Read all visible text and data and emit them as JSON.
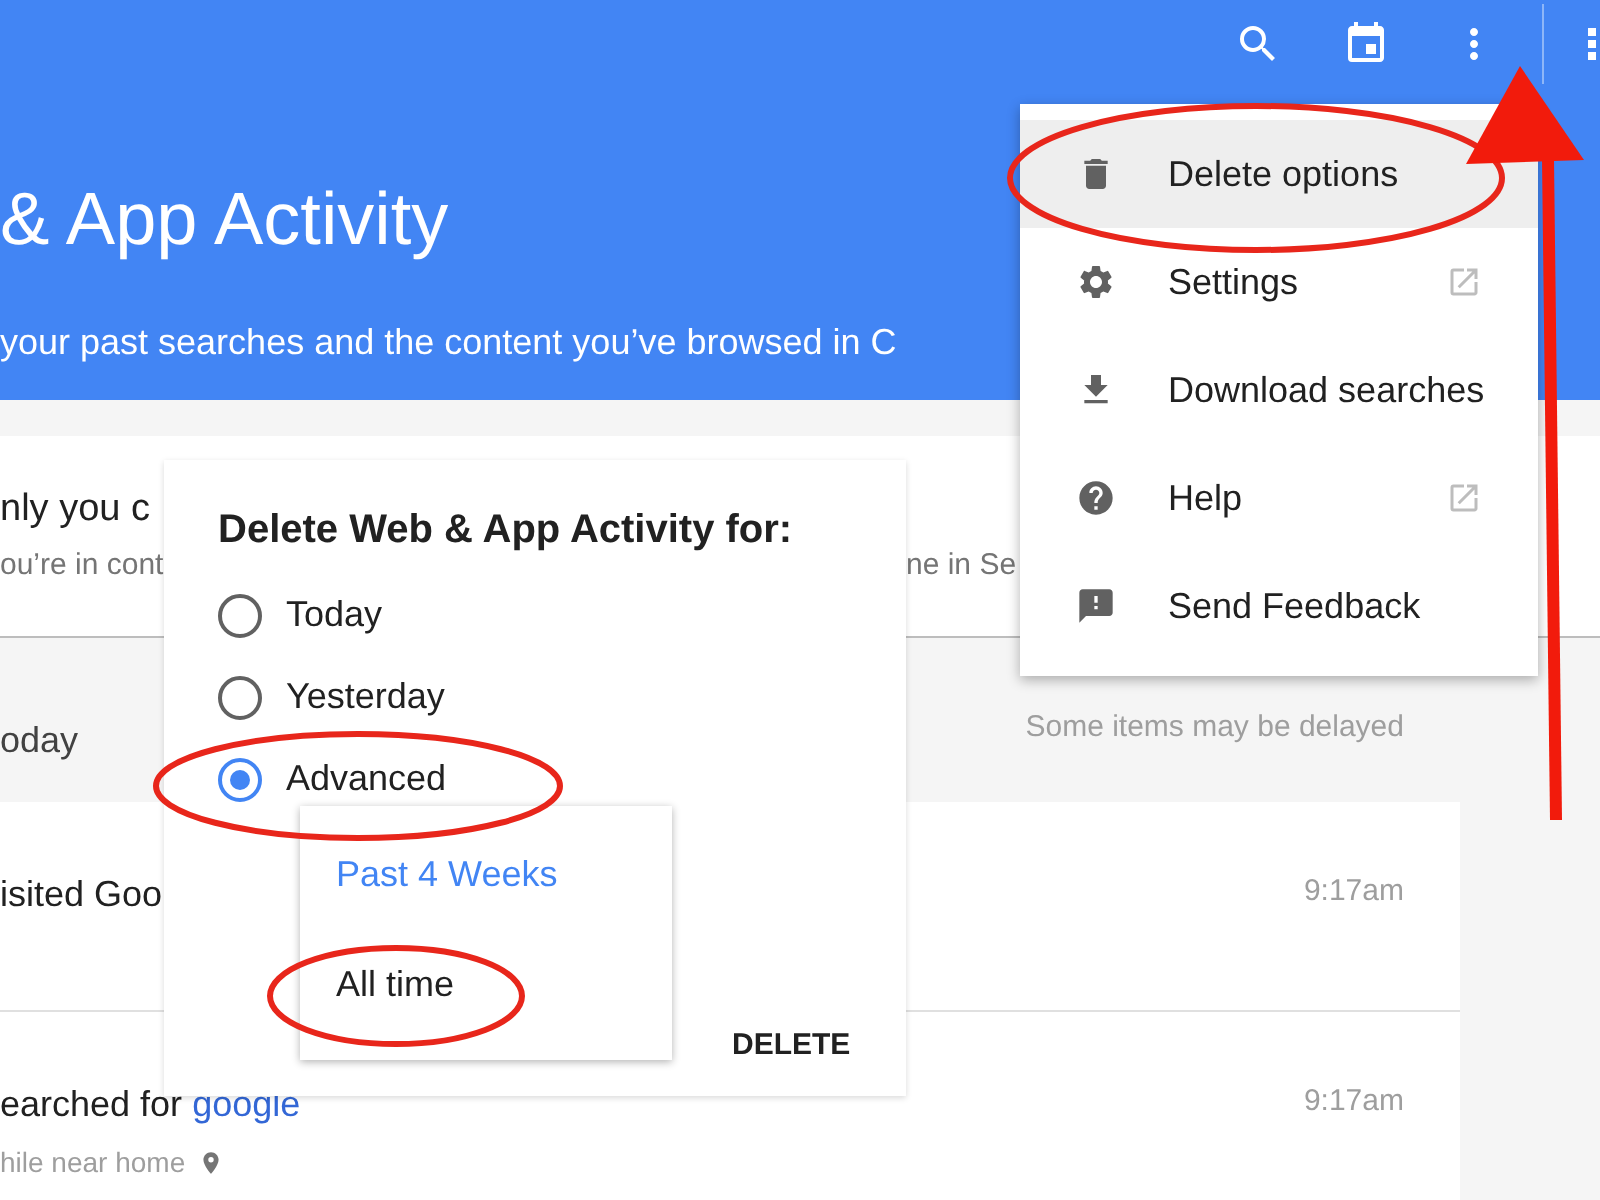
{
  "header": {
    "title": "& App Activity",
    "subtitle": "your past searches and the content you’ve browsed in C"
  },
  "notice": {
    "heading": "nly you c",
    "body": "ou’re in cont",
    "body_right": "ne in Se"
  },
  "day": {
    "label": "oday",
    "note": "Some items may be delayed"
  },
  "activity": [
    {
      "text": "isited Goo",
      "time": "9:17am"
    },
    {
      "text": "earched for",
      "link": "google",
      "detail": "hile near home",
      "time": "9:17am"
    }
  ],
  "menu": {
    "items": [
      {
        "label": "Delete options",
        "highlighted": true,
        "external": false
      },
      {
        "label": "Settings",
        "highlighted": false,
        "external": true
      },
      {
        "label": "Download searches",
        "highlighted": false,
        "external": false
      },
      {
        "label": "Help",
        "highlighted": false,
        "external": true
      },
      {
        "label": "Send Feedback",
        "highlighted": false,
        "external": false
      }
    ]
  },
  "dialog": {
    "title": "Delete Web & App Activity for:",
    "options": [
      {
        "label": "Today",
        "selected": false
      },
      {
        "label": "Yesterday",
        "selected": false
      },
      {
        "label": "Advanced",
        "selected": true
      }
    ],
    "ranges": [
      {
        "label": "Past 4 Weeks",
        "selected": true
      },
      {
        "label": "All time",
        "selected": false
      }
    ],
    "button": "DELETE"
  }
}
